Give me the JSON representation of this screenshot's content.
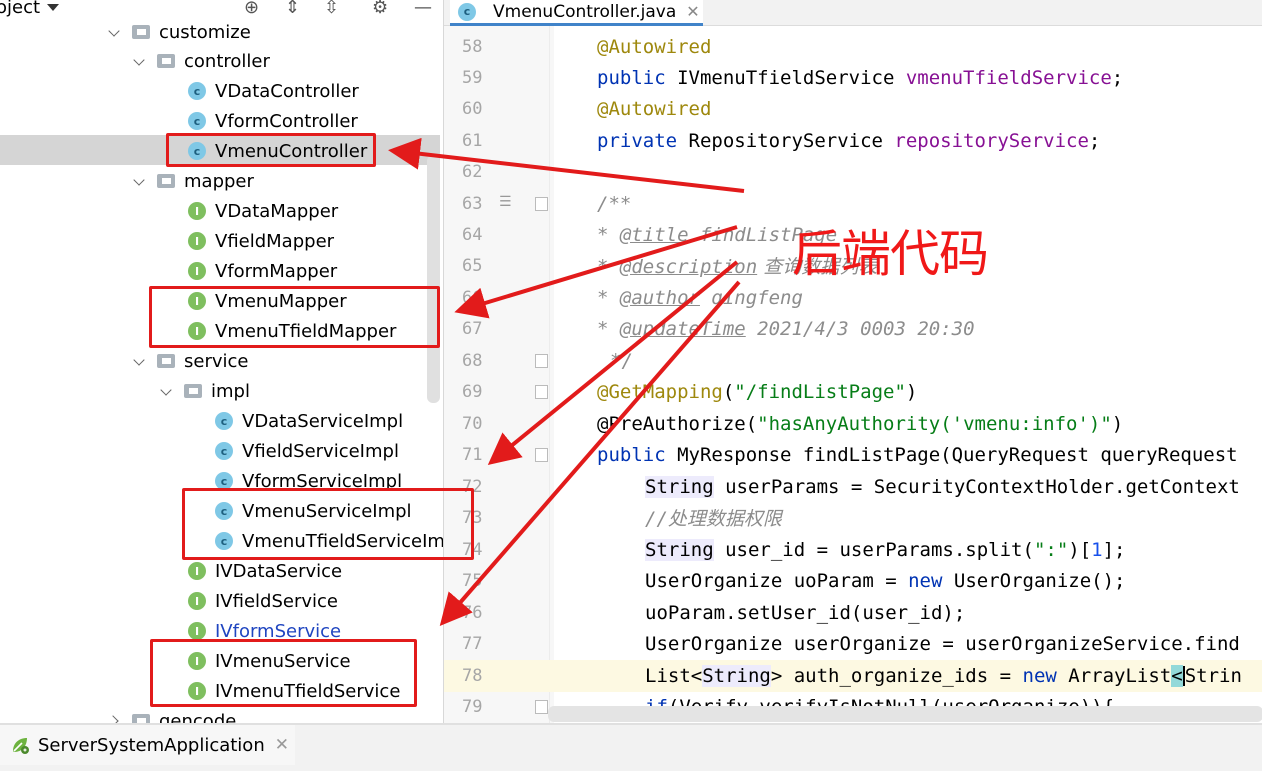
{
  "project": {
    "title": "oject",
    "tree": [
      {
        "label": "customize",
        "kind": "folder",
        "expanded": true
      },
      {
        "label": "controller",
        "kind": "folder",
        "expanded": true
      },
      {
        "label": "VDataController",
        "kind": "class"
      },
      {
        "label": "VformController",
        "kind": "class"
      },
      {
        "label": "VmenuController",
        "kind": "class",
        "selected": true
      },
      {
        "label": "mapper",
        "kind": "folder",
        "expanded": true
      },
      {
        "label": "VDataMapper",
        "kind": "interface"
      },
      {
        "label": "VfieldMapper",
        "kind": "interface"
      },
      {
        "label": "VformMapper",
        "kind": "interface"
      },
      {
        "label": "VmenuMapper",
        "kind": "interface"
      },
      {
        "label": "VmenuTfieldMapper",
        "kind": "interface"
      },
      {
        "label": "service",
        "kind": "folder",
        "expanded": true
      },
      {
        "label": "impl",
        "kind": "folder",
        "expanded": true
      },
      {
        "label": "VDataServiceImpl",
        "kind": "class"
      },
      {
        "label": "VfieldServiceImpl",
        "kind": "class"
      },
      {
        "label": "VformServiceImpl",
        "kind": "class"
      },
      {
        "label": "VmenuServiceImpl",
        "kind": "class"
      },
      {
        "label": "VmenuTfieldServiceImp",
        "kind": "class"
      },
      {
        "label": "IVDataService",
        "kind": "interface"
      },
      {
        "label": "IVfieldService",
        "kind": "interface"
      },
      {
        "label": "IVformService",
        "kind": "interface",
        "link": true
      },
      {
        "label": "IVmenuService",
        "kind": "interface"
      },
      {
        "label": "IVmenuTfieldService",
        "kind": "interface"
      },
      {
        "label": "gencode",
        "kind": "folder",
        "expanded": false
      }
    ],
    "icons": {
      "class_letter": "c",
      "interface_letter": "I"
    }
  },
  "editor": {
    "tab_label": "VmenuController.java",
    "tab_close": "✕",
    "lines": {
      "n58": "58",
      "n59": "59",
      "n60": "60",
      "n61": "61",
      "n62": "62",
      "n63": "63",
      "n64": "64",
      "n65": "65",
      "n66": "66",
      "n67": "67",
      "n68": "68",
      "n69": "69",
      "n70": "70",
      "n71": "71",
      "n72": "72",
      "n73": "73",
      "n74": "74",
      "n75": "75",
      "n76": "76",
      "n77": "77",
      "n78": "78",
      "n79": "79"
    },
    "code": {
      "l58_ann": "@Autowired",
      "l59_kw": "public",
      "l59_type": " IVmenuTfieldService ",
      "l59_field": "vmenuTfieldService",
      "l59_end": ";",
      "l60_ann": "@Autowired",
      "l61_kw": "private",
      "l61_type": " RepositoryService ",
      "l61_field": "repositoryService",
      "l61_end": ";",
      "l63_cmt": "/**",
      "l64_star": "* ",
      "l64_tag": "@title",
      "l64_text": " findListPage",
      "l65_star": "* ",
      "l65_tag": "@description",
      "l65_text": " 查询数据列表",
      "l66_star": "* ",
      "l66_tag": "@author",
      "l66_text": " qingfeng",
      "l67_star": "* ",
      "l67_tag": "@updateTime",
      "l67_text": " 2021/4/3 0003 20:30",
      "l68_cmt": "*/",
      "l69_ann": "@GetMapping",
      "l69_open": "(",
      "l69_str": "\"/findListPage\"",
      "l69_close": ")",
      "l70_ann": "@PreAuthorize",
      "l70_open": "(",
      "l70_str": "\"hasAnyAuthority('vmenu:info')\"",
      "l70_close": ")",
      "l71_kw": "public",
      "l71_rest": " MyResponse findListPage(QueryRequest queryRequest",
      "l72_type": "String",
      "l72_rest": " userParams = SecurityContextHolder.getContext",
      "l73_cmt": "//处理数据权限",
      "l74_type": "String",
      "l74_rest1": " user_id = userParams.split(",
      "l74_str": "\":\"",
      "l74_rest2": ")[",
      "l74_num": "1",
      "l74_rest3": "];",
      "l75_rest1": "UserOrganize uoParam = ",
      "l75_kw": "new",
      "l75_rest2": " UserOrganize();",
      "l76_rest": "uoParam.setUser_id(user_id);",
      "l77_rest": "UserOrganize userOrganize = userOrganizeService.find",
      "l78_rest1": "List<",
      "l78_type": "String",
      "l78_rest2": "> auth_organize_ids = ",
      "l78_kw": "new",
      "l78_rest3": " ArrayList",
      "l78_lt": "<",
      "l78_rest4": "Strin",
      "l79_kw": "if",
      "l79_rest": "(Verify.verifyIsNotNull(userOrganize)){"
    }
  },
  "annotation": {
    "text": "后端代码",
    "color": "#f01818"
  },
  "run": {
    "label": "ServerSystemApplication",
    "close": "✕"
  },
  "colors": {
    "keyword": "#0033b3",
    "annotation": "#9e880d",
    "field": "#871094",
    "string": "#067d17",
    "comment": "#8c8c8c",
    "highlight_box": "#e21b1b"
  }
}
